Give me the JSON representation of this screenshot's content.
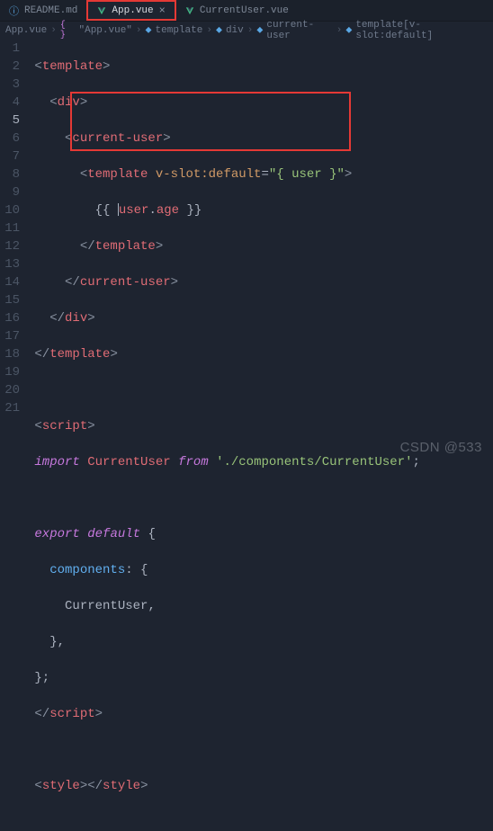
{
  "tabs": [
    {
      "label": "README.md",
      "active": false,
      "icon": "info"
    },
    {
      "label": "App.vue",
      "active": true,
      "icon": "vue"
    },
    {
      "label": "CurrentUser.vue",
      "active": false,
      "icon": "vue"
    }
  ],
  "breadcrumbs": {
    "items": [
      "App.vue",
      "\"App.vue\"",
      "template",
      "div",
      "current-user",
      "template[v-slot:default]"
    ]
  },
  "lineNumbers": [
    "1",
    "2",
    "3",
    "4",
    "5",
    "6",
    "7",
    "8",
    "9",
    "10",
    "11",
    "12",
    "13",
    "14",
    "15",
    "16",
    "17",
    "18",
    "19",
    "20",
    "21"
  ],
  "currentLine": 5,
  "code": {
    "l1": {
      "tag": "template"
    },
    "l2": {
      "tag": "div"
    },
    "l3": {
      "tag": "current-user"
    },
    "l4": {
      "tag": "template",
      "attr": "v-slot:default",
      "val": "\"{ user }\""
    },
    "l5": {
      "open": "{{ ",
      "obj": "user",
      "dot": ".",
      "prop": "age",
      "close": " }}"
    },
    "l6": {
      "tag": "template"
    },
    "l7": {
      "tag": "current-user"
    },
    "l8": {
      "tag": "div"
    },
    "l9": {
      "tag": "template"
    },
    "l11": {
      "tag": "script"
    },
    "l12": {
      "kw": "import",
      "name": "CurrentUser",
      "from": "from",
      "path": "'./components/CurrentUser'"
    },
    "l14": {
      "kw1": "export",
      "kw2": "default",
      "brace": "{"
    },
    "l15": {
      "key": "components",
      "colon": ": {",
      "after": ""
    },
    "l16": {
      "name": "CurrentUser",
      "comma": ","
    },
    "l17": {
      "close": "},"
    },
    "l18": {
      "close": "};"
    },
    "l19": {
      "tag": "script"
    },
    "l21": {
      "tag": "style"
    }
  },
  "watermark": "CSDN  @533"
}
